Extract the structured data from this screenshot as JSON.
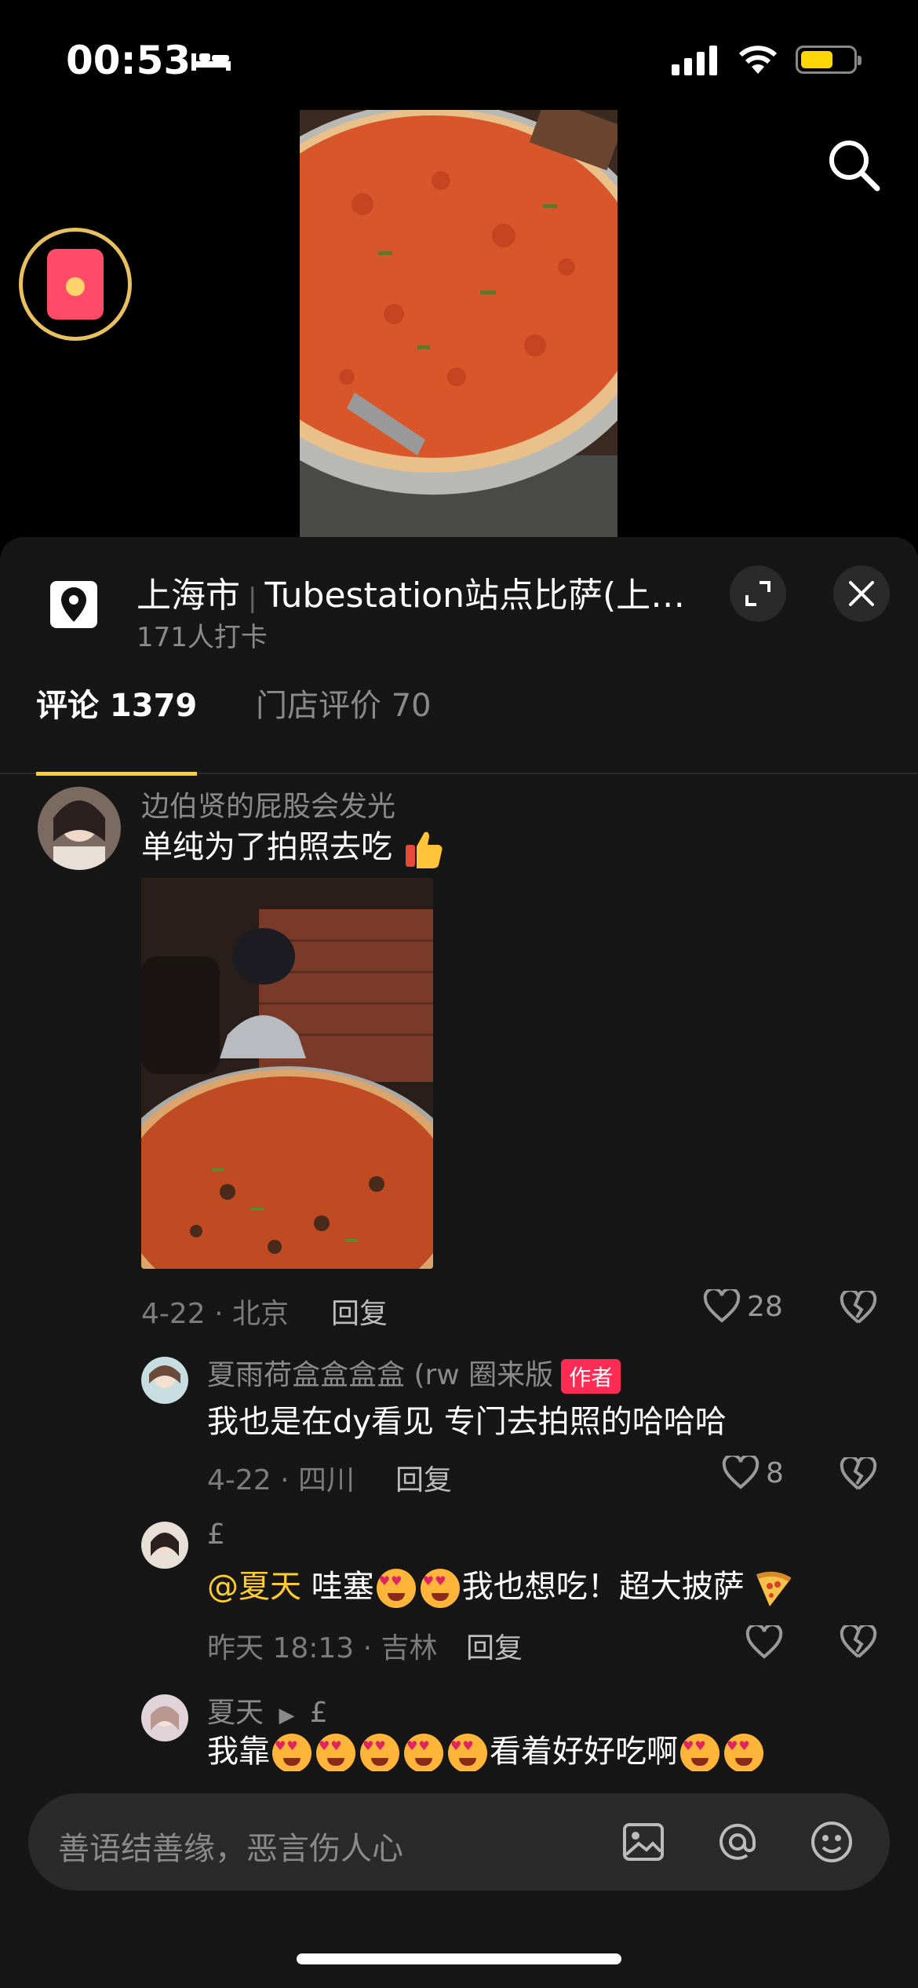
{
  "status_bar": {
    "time": "00:53"
  },
  "location": {
    "city": "上海市",
    "name": "Tubestation站点比萨(上…",
    "checkins": "171人打卡"
  },
  "tabs": [
    {
      "label": "评论 1379",
      "active": true
    },
    {
      "label": "门店评价 70",
      "active": false
    }
  ],
  "comments": [
    {
      "username": "边伯贤的屁股会发光",
      "text": "单纯为了拍照去吃",
      "date_loc": "4-22 · 北京",
      "reply_label": "回复",
      "likes": "28"
    },
    {
      "username": "夏雨荷盒盒盒盒 (rw 圈来版",
      "author_tag": "作者",
      "text": "我也是在dy看见 专门去拍照的哈哈哈",
      "date_loc": "4-22 · 四川",
      "reply_label": "回复",
      "likes": "8"
    },
    {
      "username": "£",
      "mention": "@夏天",
      "text_a": "哇塞",
      "text_b": "我也想吃！超大披萨",
      "date_loc": "昨天 18:13 · 吉林",
      "reply_label": "回复"
    },
    {
      "username": "夏天",
      "reply_to": "£",
      "text_a": "我靠",
      "text_b": "看着好好吃啊"
    }
  ],
  "input": {
    "placeholder": "善语结善缘，恶言伤人心"
  },
  "colors": {
    "accent": "#ffcb2e",
    "author_tag": "#fe2c55",
    "sheet_bg": "#161616"
  }
}
